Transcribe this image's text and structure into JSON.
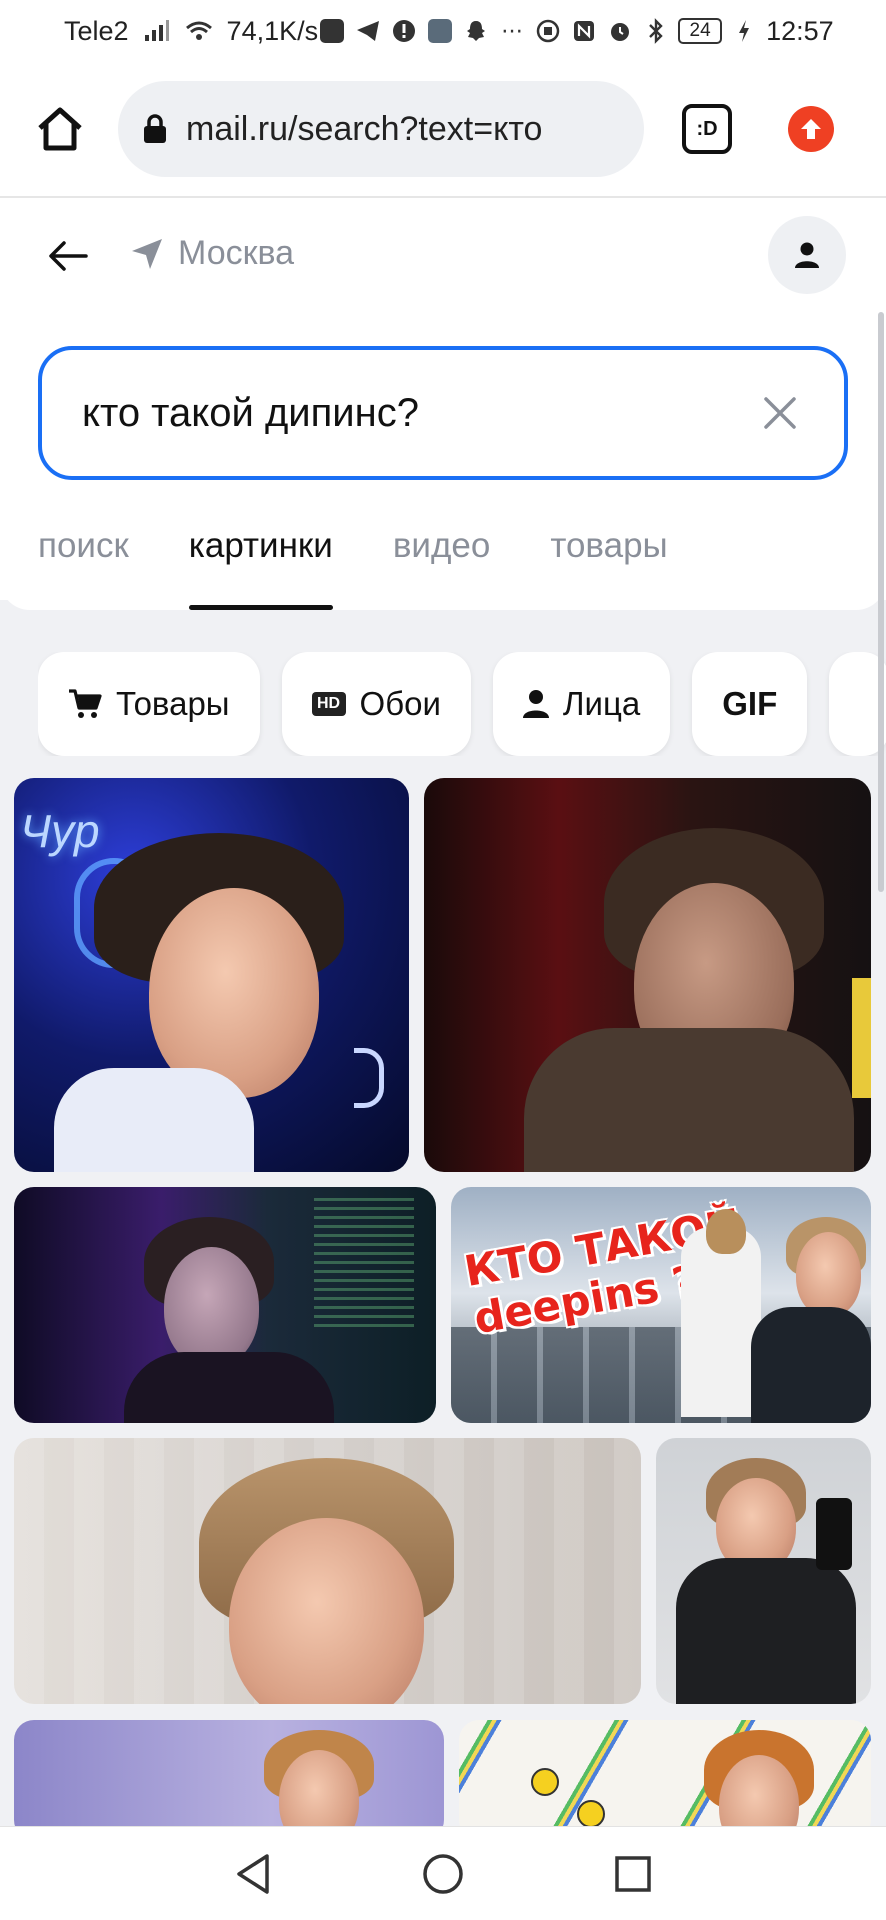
{
  "status_bar": {
    "carrier": "Tele2",
    "net_speed": "74,1K/s",
    "battery": "24",
    "time": "12:57"
  },
  "browser": {
    "url": "mail.ru/search?text=кто",
    "tabs_glyph": ":D"
  },
  "header": {
    "location": "Москва"
  },
  "search": {
    "query": "кто такой дипинс?"
  },
  "tabs": [
    {
      "label": "поиск",
      "active": false
    },
    {
      "label": "картинки",
      "active": true
    },
    {
      "label": "видео",
      "active": false
    },
    {
      "label": "товары",
      "active": false
    }
  ],
  "chips": [
    {
      "label": "Товары",
      "icon": "cart-icon"
    },
    {
      "label": "Обои",
      "icon": "hd-icon",
      "badge": "HD"
    },
    {
      "label": "Лица",
      "icon": "person-icon"
    },
    {
      "label": "GIF",
      "icon": ""
    }
  ],
  "results": {
    "overlay_line1": "КТО ТАКОЙ",
    "overlay_line2": "deepins ?",
    "neon_text": "Чур"
  },
  "colors": {
    "accent": "#1a6ff5",
    "update": "#ef4023",
    "overlay_red": "#e7241c"
  }
}
